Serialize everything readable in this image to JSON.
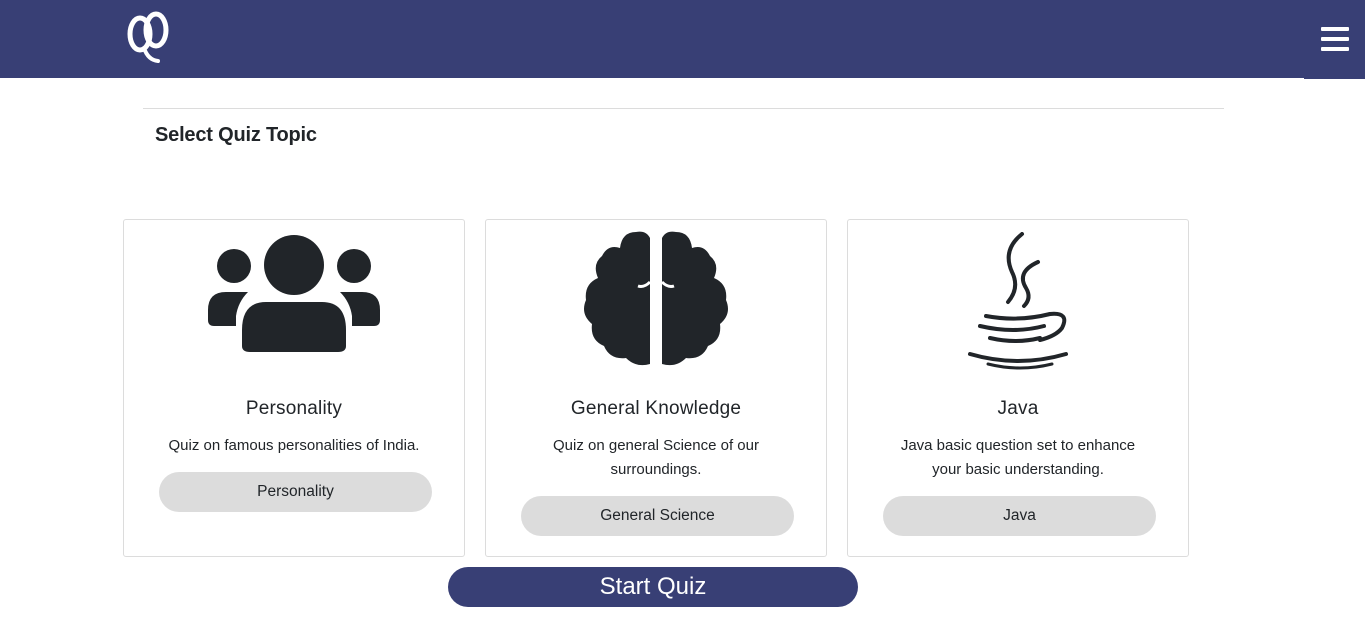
{
  "header": {
    "logo_icon": "quiz-logo-icon",
    "menu_icon": "hamburger-menu-icon",
    "background_color": "#383f75"
  },
  "main": {
    "section_title": "Select Quiz Topic",
    "cards": [
      {
        "icon": "users-group-icon",
        "title": "Personality",
        "description": "Quiz on famous personalities of India.",
        "button_label": "Personality"
      },
      {
        "icon": "brain-icon",
        "title": "General Knowledge",
        "description": "Quiz on general Science of our surroundings.",
        "button_label": "General Science"
      },
      {
        "icon": "java-icon",
        "title": "Java",
        "description": "Java basic question set to enhance your basic understanding.",
        "button_label": "Java"
      }
    ],
    "start_button_label": "Start Quiz"
  },
  "colors": {
    "primary": "#383f75",
    "button_gray": "#dcdcdc",
    "icon_dark": "#212529"
  }
}
